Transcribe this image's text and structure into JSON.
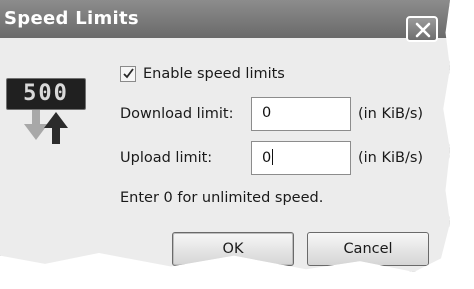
{
  "window": {
    "title": "Speed Limits"
  },
  "icons": {
    "close": "close-icon",
    "speed_display": "speed-limit-icon",
    "arrows": "download-upload-arrows-icon"
  },
  "speed_icon": {
    "digits": "500"
  },
  "enable_checkbox": {
    "label": "Enable speed limits",
    "checked": true
  },
  "download": {
    "label": "Download limit:",
    "value": "0",
    "unit": "(in KiB/s)"
  },
  "upload": {
    "label": "Upload limit:",
    "value": "0",
    "unit": "(in KiB/s)"
  },
  "hint": "Enter 0 for unlimited speed.",
  "buttons": {
    "ok": "OK",
    "cancel": "Cancel"
  }
}
